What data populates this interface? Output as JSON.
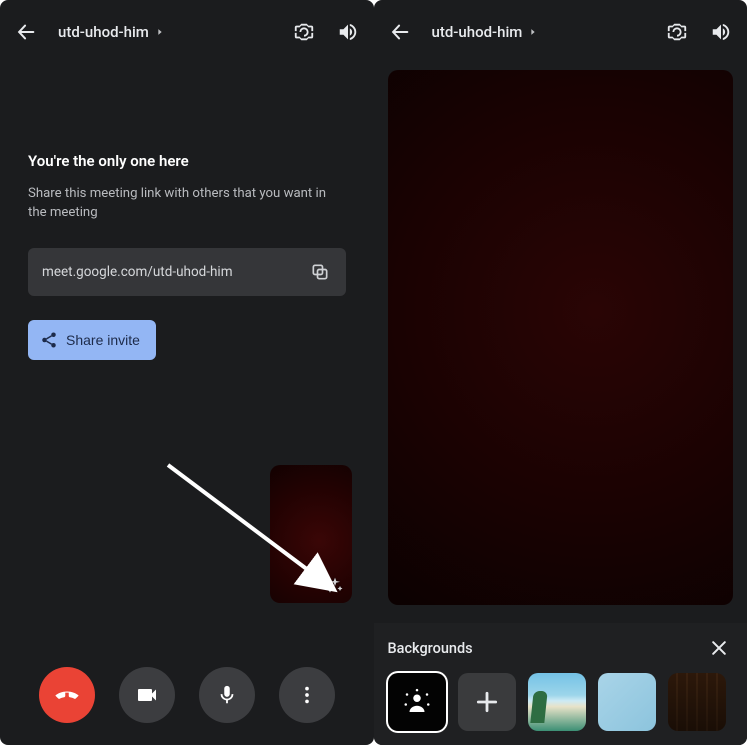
{
  "left": {
    "header": {
      "meeting_code": "utd-uhod-him"
    },
    "title": "You're the only one here",
    "subtitle": "Share this meeting link with others that you want in the meeting",
    "meeting_link": "meet.google.com/utd-uhod-him",
    "share_button_label": "Share invite"
  },
  "right": {
    "header": {
      "meeting_code": "utd-uhod-him"
    },
    "backgrounds": {
      "title": "Backgrounds",
      "tiles": [
        "no-effect",
        "add",
        "beach",
        "sky",
        "library"
      ]
    }
  }
}
